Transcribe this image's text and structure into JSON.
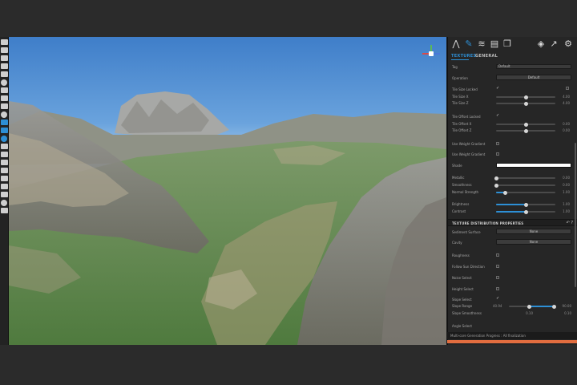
{
  "panel": {
    "tabs": [
      "TEXTURES",
      "GENERAL"
    ],
    "icons": [
      "terrain-icon",
      "brush-icon",
      "water-icon",
      "map-icon",
      "copy-icon",
      "cube-icon",
      "share-icon",
      "gear-icon"
    ]
  },
  "general": {
    "tag_label": "Tag",
    "tag_value": "Default",
    "operation_label": "Operation",
    "operation_value": "Default",
    "tile_size_locked_label": "Tile Size Locked",
    "tile_size_x_label": "Tile Size X",
    "tile_size_x_value": "4.00",
    "tile_size_x_level": 0.5,
    "tile_size_z_label": "Tile Size Z",
    "tile_size_z_value": "4.00",
    "tile_size_z_level": 0.5,
    "tile_offset_locked_label": "Tile Offset Locked",
    "tile_offset_x_label": "Tile Offset X",
    "tile_offset_x_value": "0.00",
    "tile_offset_x_level": 0.5,
    "tile_offset_z_label": "Tile Offset Z",
    "tile_offset_z_value": "0.00",
    "tile_offset_z_level": 0.5,
    "use_weight_gradient_label": "Use Weight Gradient",
    "use_weight_gradient2_label": "Use Weight Gradient",
    "shade_label": "Shade",
    "metallic_label": "Metallic",
    "metallic_value": "0.00",
    "metallic_level": 0.0,
    "smoothness_label": "Smoothness",
    "smoothness_value": "0.00",
    "smoothness_level": 0.0,
    "normal_strength_label": "Normal Strength",
    "normal_strength_value": "1.00",
    "normal_strength_level": 0.15,
    "brightness_label": "Brightness",
    "brightness_value": "1.00",
    "brightness_level": 0.5,
    "contrast_label": "Contrast",
    "contrast_value": "1.00",
    "contrast_level": 0.5
  },
  "distribution": {
    "title": "TEXTURE DISTRIBUTION PROPERTIES",
    "header_icons": "↶ ?",
    "sediment_surface_label": "Sediment Surface",
    "sediment_surface_value": "None",
    "cavity_label": "Cavity",
    "cavity_value": "None",
    "roughness_label": "Roughness",
    "follow_sun_direction_label": "Follow Sun Direction",
    "noise_select_label": "Noise Select",
    "height_select_label": "Height Select",
    "slope_select_label": "Slope Select",
    "slope_range_label": "Slope Range",
    "slope_range_min": "40.94",
    "slope_range_max": "90.00",
    "slope_range_low_level": 0.45,
    "slope_range_high_level": 1.0,
    "slope_smoothness_label": "Slope Smoothness",
    "slope_smoothness_min": "0.10",
    "slope_smoothness_max": "0.10",
    "angle_select_label": "Angle Select"
  },
  "status": {
    "text": "Multi-core Generation Progress : All finalization",
    "accent": "#e26d3f"
  },
  "colors": {
    "accent": "#2d8fd5"
  }
}
